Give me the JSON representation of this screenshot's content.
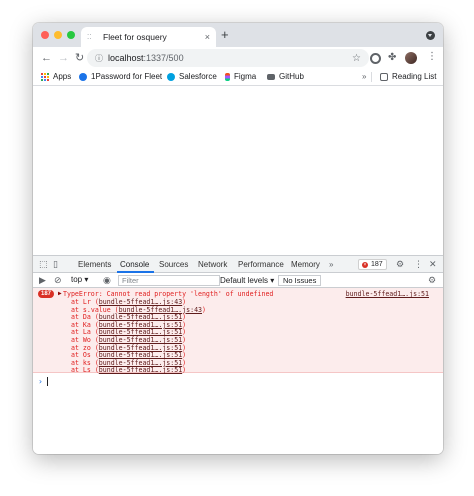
{
  "tab": {
    "title": "Fleet for osquery",
    "close": "×"
  },
  "toolbar": {
    "back": "←",
    "forward": "→",
    "reload": "↻",
    "url_host": "localhost",
    "url_path": ":1337/500",
    "star": "☆",
    "menu": "⋮"
  },
  "bookmarks": [
    {
      "label": "Apps",
      "icon": "apps-grid-icon"
    },
    {
      "label": "1Password for Fleet",
      "icon": "info-icon"
    },
    {
      "label": "Salesforce",
      "icon": "cloud-icon"
    },
    {
      "label": "Figma",
      "icon": "figma-icon"
    },
    {
      "label": "GitHub",
      "icon": "folder-icon"
    }
  ],
  "bookmarks_more": "»",
  "reading_list": "Reading List",
  "devtools": {
    "tabs": [
      "Elements",
      "Console",
      "Sources",
      "Network",
      "Performance",
      "Memory"
    ],
    "more_tabs": "»",
    "error_count": "187",
    "context": "top ▾",
    "filter_placeholder": "Filter",
    "levels": "Default levels ▾",
    "issues": "No Issues"
  },
  "console": {
    "badge": "187",
    "error_message": "TypeError: Cannot read property 'length' of undefined",
    "error_source": "bundle-5ffead1….js:51",
    "stack": [
      {
        "fn": "at Lr (",
        "loc": "bundle-5ffead1….js:43",
        "end": ")"
      },
      {
        "fn": "at s.value (",
        "loc": "bundle-5ffead1….js:43",
        "end": ")"
      },
      {
        "fn": "at Da (",
        "loc": "bundle-5ffead1….js:51",
        "end": ")"
      },
      {
        "fn": "at Ka (",
        "loc": "bundle-5ffead1….js:51",
        "end": ")"
      },
      {
        "fn": "at La (",
        "loc": "bundle-5ffead1….js:51",
        "end": ")"
      },
      {
        "fn": "at Wo (",
        "loc": "bundle-5ffead1….js:51",
        "end": ")"
      },
      {
        "fn": "at zo (",
        "loc": "bundle-5ffead1….js:51",
        "end": ")"
      },
      {
        "fn": "at Os (",
        "loc": "bundle-5ffead1….js:51",
        "end": ")"
      },
      {
        "fn": "at ks (",
        "loc": "bundle-5ffead1….js:51",
        "end": ")"
      },
      {
        "fn": "at Ls (",
        "loc": "bundle-5ffead1….js:51",
        "end": ")"
      }
    ],
    "prompt": "›"
  }
}
